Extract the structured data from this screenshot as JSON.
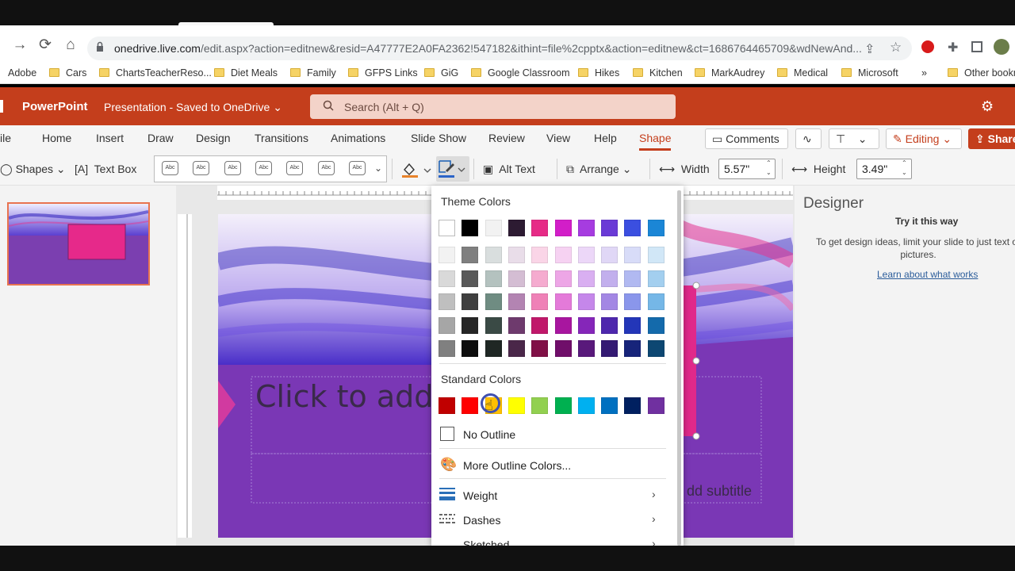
{
  "browser": {
    "url_host": "onedrive.live.com",
    "url_rest": "/edit.aspx?action=editnew&resid=A47777E2A0FA2362!547182&ithint=file%2cpptx&action=editnew&ct=1686764465709&wdNewAnd...",
    "bookmarks": [
      "Adobe",
      "Cars",
      "ChartsTeacherReso...",
      "Diet Meals",
      "Family",
      "GFPS Links",
      "GiG",
      "Google Classroom",
      "Hikes",
      "Kitchen",
      "MarkAudrey",
      "Medical",
      "Microsoft",
      "»",
      "Other bookm"
    ]
  },
  "app": {
    "name": "PowerPoint",
    "doc_title": "Presentation  -  Saved to OneDrive",
    "search_placeholder": "Search (Alt + Q)"
  },
  "ribbon": {
    "tabs": [
      "ile",
      "Home",
      "Insert",
      "Draw",
      "Design",
      "Transitions",
      "Animations",
      "Slide Show",
      "Review",
      "View",
      "Help",
      "Shape"
    ],
    "active_tab": "Shape",
    "comments_label": "Comments",
    "editing_label": "Editing",
    "share_label": "Share",
    "shapes_label": "Shapes",
    "textbox_label": "Text Box",
    "style_sample": "Abc",
    "alttext_label": "Alt Text",
    "arrange_label": "Arrange",
    "width_label": "Width",
    "width_value": "5.57\"",
    "height_label": "Height",
    "height_value": "3.49\""
  },
  "slide": {
    "title_placeholder": "Click to add",
    "subtitle_placeholder": "dd subtitle"
  },
  "designer": {
    "title": "Designer",
    "subtitle": "Try it this way",
    "body": "To get design ideas, limit your slide to just text or pictures.",
    "link": "Learn about what works"
  },
  "outline_menu": {
    "theme_colors_label": "Theme Colors",
    "standard_colors_label": "Standard Colors",
    "theme_top": [
      "#ffffff",
      "#000000",
      "#f2f2f2",
      "#2d1b32",
      "#e62b86",
      "#d21ec8",
      "#a63ce0",
      "#6a3ad6",
      "#3b4fe0",
      "#1b86d6"
    ],
    "theme_rows": [
      [
        "#f2f2f2",
        "#7f7f7f",
        "#d9dede",
        "#e9dde9",
        "#fad5e7",
        "#f6d2f2",
        "#ecd7f8",
        "#e0d7f6",
        "#d8dcf8",
        "#d1e7f7"
      ],
      [
        "#d9d9d9",
        "#595959",
        "#b4c2bf",
        "#d4bdd3",
        "#f5abcf",
        "#ed a6e6",
        "#d9aff1",
        "#c2afed",
        "#b1b9f1",
        "#a3cfef"
      ],
      [
        "#bfbfbf",
        "#3f3f3f",
        "#6f8c82",
        "#b384b2",
        "#ef81b7",
        "#e47ad9",
        "#c587ea",
        "#a387e4",
        "#8a96eb",
        "#75b7e7"
      ],
      [
        "#a6a6a6",
        "#262626",
        "#3a4a45",
        "#6e3a6d",
        "#c0186a",
        "#a8169f",
        "#8526b9",
        "#4e27ad",
        "#2336b8",
        "#146aab"
      ],
      [
        "#808080",
        "#0d0d0d",
        "#1f2724",
        "#4a2749",
        "#801046",
        "#700e6a",
        "#59197b",
        "#341a73",
        "#17247a",
        "#0d4772"
      ]
    ],
    "standard": [
      "#c00000",
      "#ff0000",
      "#ffc000",
      "#ffff00",
      "#92d050",
      "#00b050",
      "#00b0f0",
      "#0070c0",
      "#002060",
      "#7030a0"
    ],
    "no_outline_label": "No Outline",
    "more_colors_label": "More Outline Colors...",
    "weight_label": "Weight",
    "dashes_label": "Dashes",
    "sketched_label": "Sketched"
  }
}
